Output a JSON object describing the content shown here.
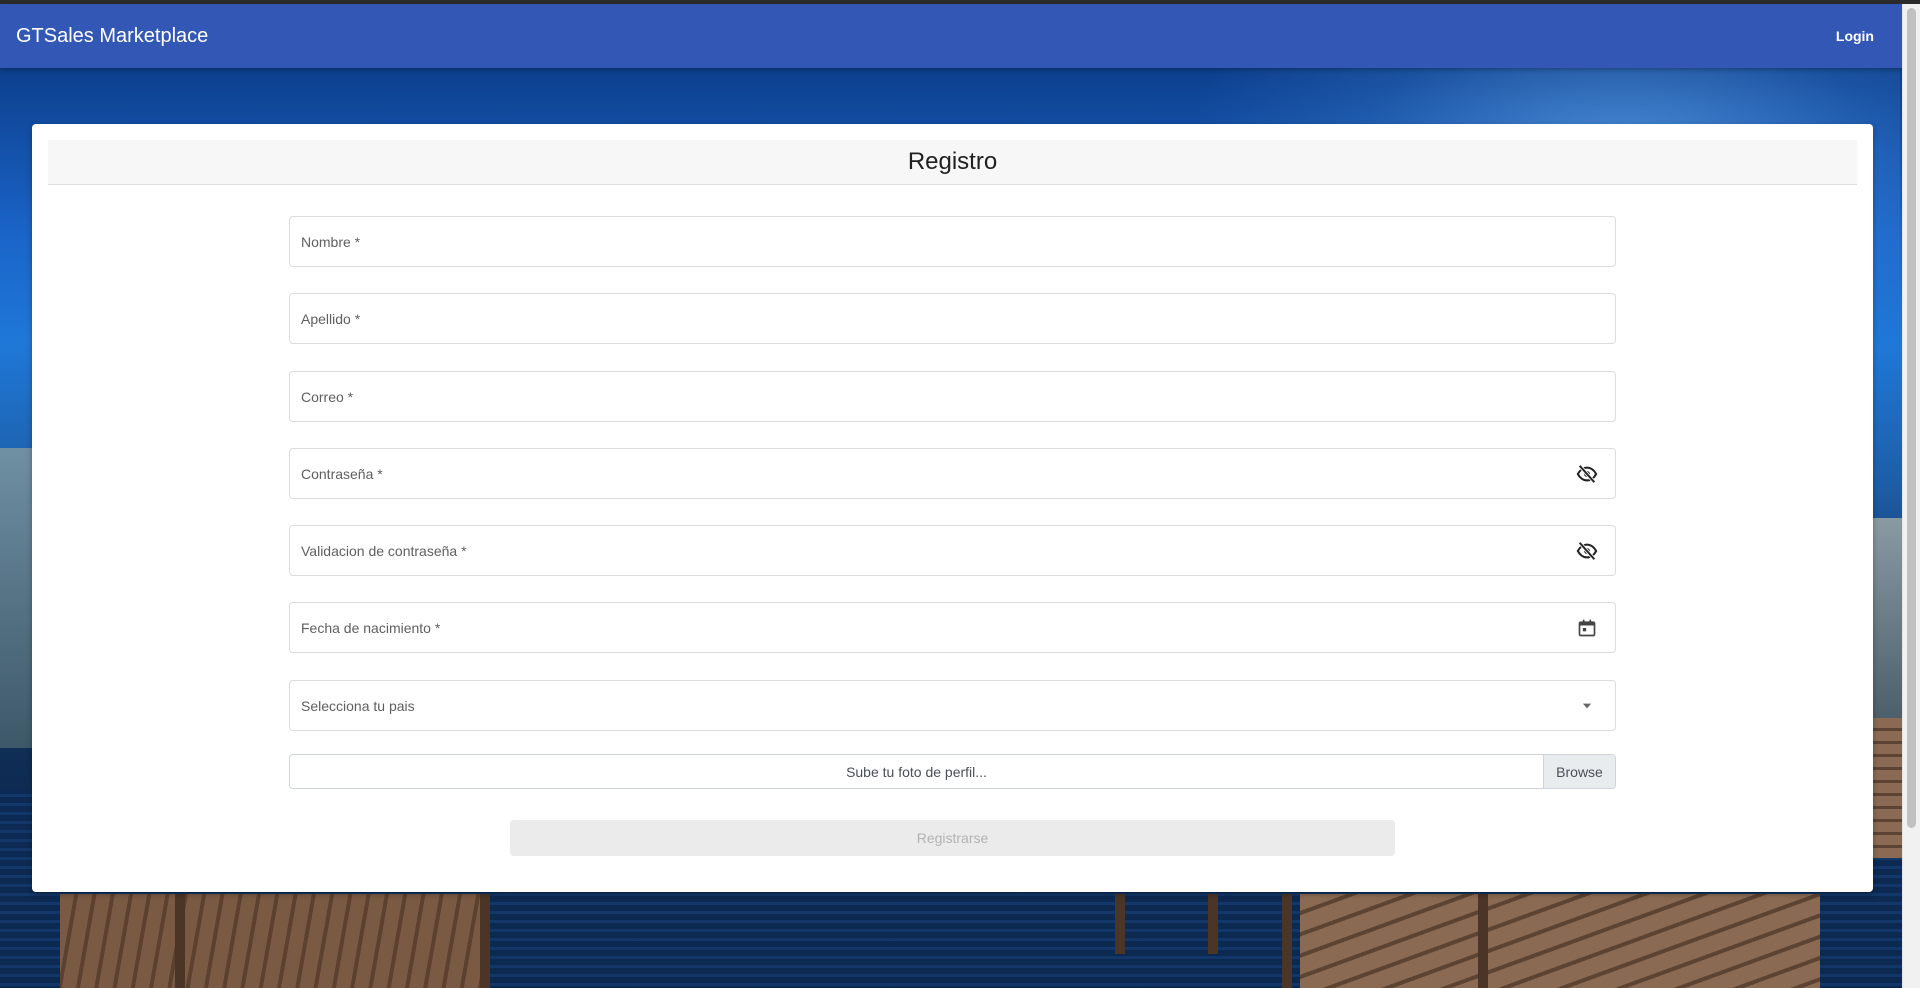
{
  "navbar": {
    "brand": "GTSales Marketplace",
    "login_label": "Login",
    "color": "#3357b5"
  },
  "card": {
    "title": "Registro"
  },
  "form": {
    "fields": [
      {
        "label": "Nombre *",
        "icon": null
      },
      {
        "label": "Apellido *",
        "icon": null
      },
      {
        "label": "Correo *",
        "icon": null
      },
      {
        "label": "Contraseña *",
        "icon": "eye-off-icon"
      },
      {
        "label": "Validacion de contraseña *",
        "icon": "eye-off-icon"
      },
      {
        "label": "Fecha de nacimiento *",
        "icon": "calendar-icon"
      },
      {
        "label": "Selecciona tu pais",
        "icon": "dropdown-arrow-icon"
      }
    ],
    "file_upload": {
      "label": "Sube tu foto de perfil...",
      "browse_label": "Browse"
    },
    "submit_label": "Registrarse"
  }
}
